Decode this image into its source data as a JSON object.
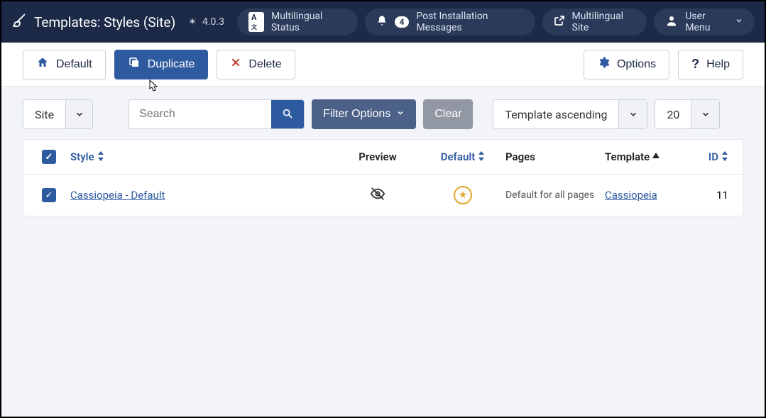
{
  "header": {
    "title": "Templates: Styles (Site)",
    "version": "4.0.3",
    "multilingual_status": "Multilingual Status",
    "post_install_count": "4",
    "post_install_label": "Post Installation Messages",
    "multilingual_site": "Multilingual Site",
    "user_menu": "User Menu"
  },
  "toolbar": {
    "default_label": "Default",
    "duplicate_label": "Duplicate",
    "delete_label": "Delete",
    "options_label": "Options",
    "help_label": "Help"
  },
  "filters": {
    "scope": "Site",
    "search_placeholder": "Search",
    "filter_options": "Filter Options",
    "clear": "Clear",
    "sort": "Template ascending",
    "page_size": "20"
  },
  "table": {
    "headers": {
      "style": "Style",
      "preview": "Preview",
      "default": "Default",
      "pages": "Pages",
      "template": "Template",
      "id": "ID"
    },
    "rows": [
      {
        "checked": true,
        "style": "Cassiopeia - Default",
        "pages": "Default for all pages",
        "template": "Cassiopeia",
        "id": "11",
        "is_default": true
      }
    ]
  }
}
